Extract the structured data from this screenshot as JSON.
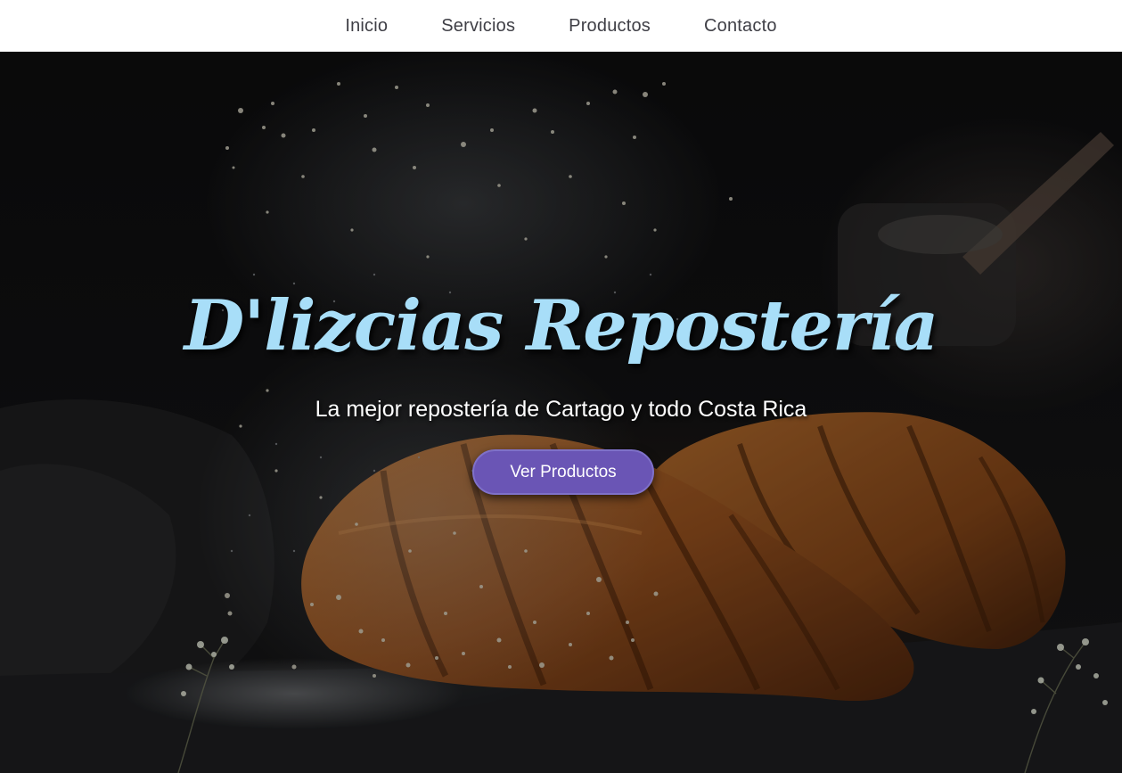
{
  "nav": {
    "items": [
      {
        "label": "Inicio"
      },
      {
        "label": "Servicios"
      },
      {
        "label": "Productos"
      },
      {
        "label": "Contacto"
      }
    ]
  },
  "hero": {
    "title": "D'lizcias Repostería",
    "subtitle": "La mejor repostería de Cartago y todo Costa Rica",
    "cta_label": "Ver Productos",
    "background_image": "croissants-with-flour-dust"
  },
  "colors": {
    "nav_background": "#ffffff",
    "nav_text": "#3f3f46",
    "title": "#a8def8",
    "cta_background": "#6a55b5",
    "hero_overlay": "#0f0f10"
  }
}
